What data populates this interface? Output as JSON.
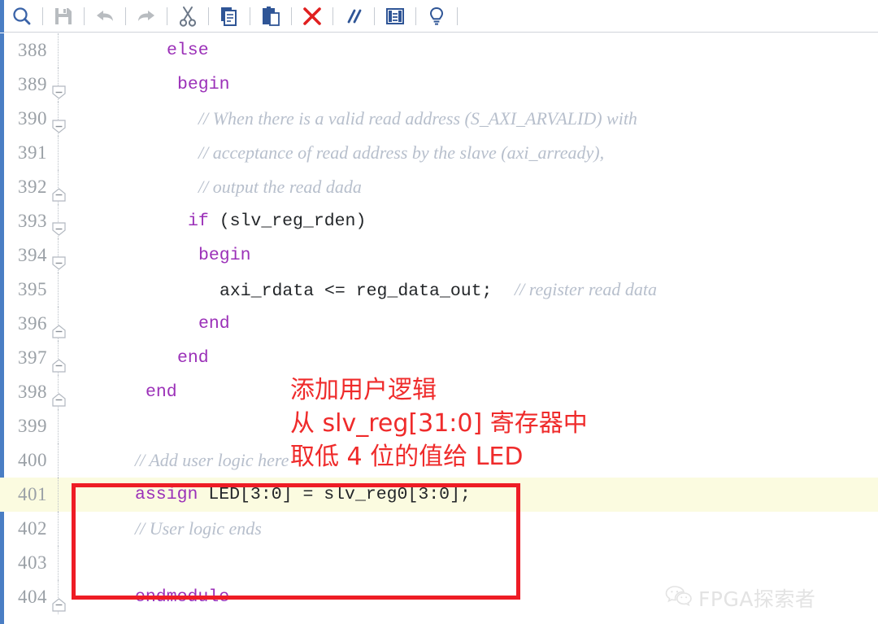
{
  "toolbar": {
    "buttons": [
      {
        "name": "search-icon",
        "label": "Find",
        "color": "#3a63a8",
        "state": "enabled"
      },
      {
        "name": "save-icon",
        "label": "Save",
        "color": "#b8bcc0",
        "state": "disabled"
      },
      {
        "name": "undo-icon",
        "label": "Undo",
        "color": "#b8bcc0",
        "state": "disabled"
      },
      {
        "name": "redo-icon",
        "label": "Redo",
        "color": "#b8bcc0",
        "state": "disabled"
      },
      {
        "name": "cut-icon",
        "label": "Cut",
        "color": "#6b7787",
        "state": "enabled"
      },
      {
        "name": "copy-icon",
        "label": "Copy",
        "color": "#2f5596",
        "state": "enabled"
      },
      {
        "name": "paste-icon",
        "label": "Paste",
        "color": "#2f5596",
        "state": "enabled"
      },
      {
        "name": "delete-icon",
        "label": "Delete",
        "color": "#e02020",
        "state": "enabled"
      },
      {
        "name": "comment-icon",
        "label": "Toggle Comment",
        "color": "#2f5596",
        "state": "enabled"
      },
      {
        "name": "columns-icon",
        "label": "Show Columns",
        "color": "#2f5596",
        "state": "enabled"
      },
      {
        "name": "bulb-icon",
        "label": "Hints",
        "color": "#2f5596",
        "state": "enabled"
      }
    ]
  },
  "editor": {
    "language": "verilog",
    "current_line": 401,
    "accent_color": "#4a7ec4",
    "keyword_color": "#9b30b8",
    "comment_color": "#b7bfcc",
    "current_line_color": "#fbfbe0",
    "lines": [
      {
        "num": "388",
        "fold": "none",
        "indent": 9,
        "tokens": [
          {
            "t": "kw",
            "v": "else"
          }
        ]
      },
      {
        "num": "389",
        "fold": "start",
        "indent": 10,
        "tokens": [
          {
            "t": "kw",
            "v": "begin"
          }
        ]
      },
      {
        "num": "390",
        "fold": "start",
        "indent": 12,
        "tokens": [
          {
            "t": "cmt",
            "v": "// When there is a valid read address (S_AXI_ARVALID) with"
          }
        ]
      },
      {
        "num": "391",
        "fold": "none",
        "indent": 12,
        "tokens": [
          {
            "t": "cmt",
            "v": "// acceptance of read address by the slave (axi_arready),"
          }
        ]
      },
      {
        "num": "392",
        "fold": "end",
        "indent": 12,
        "tokens": [
          {
            "t": "cmt",
            "v": "// output the read dada"
          }
        ]
      },
      {
        "num": "393",
        "fold": "start",
        "indent": 11,
        "tokens": [
          {
            "t": "kw",
            "v": "if"
          },
          {
            "t": "idn",
            "v": " (slv_reg_rden)"
          }
        ]
      },
      {
        "num": "394",
        "fold": "start",
        "indent": 12,
        "tokens": [
          {
            "t": "kw",
            "v": "begin"
          }
        ]
      },
      {
        "num": "395",
        "fold": "none",
        "indent": 14,
        "tokens": [
          {
            "t": "idn",
            "v": "axi_rdata <= reg_data_out;"
          },
          {
            "t": "cmt",
            "v": "     // register read data"
          }
        ]
      },
      {
        "num": "396",
        "fold": "end",
        "indent": 12,
        "tokens": [
          {
            "t": "kw",
            "v": "end"
          }
        ]
      },
      {
        "num": "397",
        "fold": "end",
        "indent": 10,
        "tokens": [
          {
            "t": "kw",
            "v": "end"
          }
        ]
      },
      {
        "num": "398",
        "fold": "end",
        "indent": 7,
        "tokens": [
          {
            "t": "kw",
            "v": "end"
          }
        ]
      },
      {
        "num": "399",
        "fold": "none",
        "indent": 0,
        "tokens": []
      },
      {
        "num": "400",
        "fold": "none",
        "indent": 6,
        "tokens": [
          {
            "t": "cmt",
            "v": "// Add user logic here"
          }
        ]
      },
      {
        "num": "401",
        "fold": "none",
        "indent": 6,
        "tokens": [
          {
            "t": "kw",
            "v": "assign"
          },
          {
            "t": "idn",
            "v": " LED[3:0] = slv_reg0[3:0];"
          }
        ]
      },
      {
        "num": "402",
        "fold": "none",
        "indent": 6,
        "tokens": [
          {
            "t": "cmt",
            "v": "// User logic ends"
          }
        ]
      },
      {
        "num": "403",
        "fold": "none",
        "indent": 0,
        "tokens": []
      },
      {
        "num": "404",
        "fold": "end",
        "indent": 6,
        "tokens": [
          {
            "t": "kw",
            "v": "endmodule"
          }
        ]
      }
    ]
  },
  "annotation": {
    "color": "#ef2b2b",
    "lines": [
      "添加用户逻辑",
      "从 slv_reg[31:0] 寄存器中",
      "取低 4 位的值给 LED"
    ]
  },
  "highlight_box": {
    "color": "#ee1c25",
    "covers_lines": "400-402"
  },
  "watermark": {
    "icon": "wechat-icon",
    "text": "FPGA探索者",
    "color": "#e3e3e3"
  }
}
